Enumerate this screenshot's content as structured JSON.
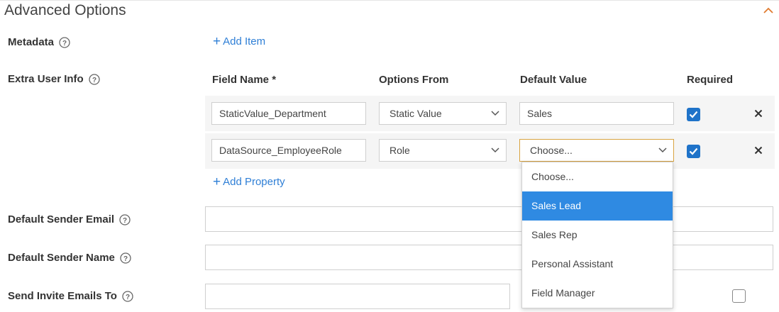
{
  "section": {
    "title": "Advanced Options"
  },
  "metadata": {
    "label": "Metadata",
    "add_item": "Add Item"
  },
  "extra_user_info": {
    "label": "Extra User Info",
    "columns": {
      "field_name": "Field Name *",
      "options_from": "Options From",
      "default_value": "Default Value",
      "required": "Required"
    },
    "rows": [
      {
        "field_name": "StaticValue_Department",
        "options_from": "Static Value",
        "default_value": "Sales",
        "required": true
      },
      {
        "field_name": "DataSource_EmployeeRole",
        "options_from": "Role",
        "default_value": "Choose...",
        "required": true
      }
    ],
    "add_property": "Add Property"
  },
  "default_sender_email": {
    "label": "Default Sender Email",
    "value": ""
  },
  "default_sender_name": {
    "label": "Default Sender Name",
    "value": ""
  },
  "send_invite_emails_to": {
    "label": "Send Invite Emails To",
    "value": "",
    "checkbox_checked": false
  },
  "dropdown": {
    "options": [
      "Choose...",
      "Sales Lead",
      "Sales Rep",
      "Personal Assistant",
      "Field Manager"
    ],
    "highlighted_index": 1
  },
  "colors": {
    "accent": "#2f7fd6",
    "checkbox": "#1f73c9",
    "highlight": "#2f8ae2",
    "active_border": "#d9a441"
  }
}
